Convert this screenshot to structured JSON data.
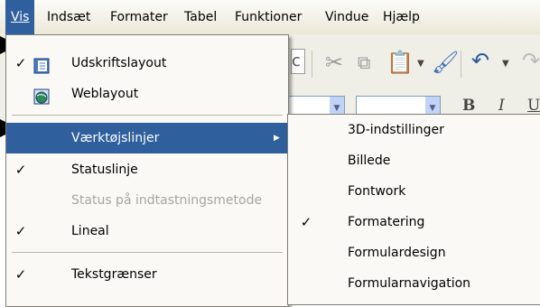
{
  "menubar": {
    "items": [
      {
        "label": "Vis",
        "active": true
      },
      {
        "label": "Indsæt"
      },
      {
        "label": "Formater"
      },
      {
        "label": "Tabel"
      },
      {
        "label": "Funktioner"
      },
      {
        "label": "Vindue"
      },
      {
        "label": "Hjælp"
      }
    ]
  },
  "view_menu": {
    "items": [
      {
        "label": "Udskriftslayout",
        "checked": true,
        "icon": "print-layout-icon"
      },
      {
        "label": "Weblayout",
        "checked": false,
        "icon": "web-layout-icon"
      },
      {
        "label": "Værktøjslinjer",
        "submenu": true,
        "highlighted": true
      },
      {
        "label": "Statuslinje",
        "checked": true
      },
      {
        "label": "Status på indtastningsmetode",
        "disabled": true
      },
      {
        "label": "Lineal",
        "checked": true
      },
      {
        "label": "Tekstgrænser",
        "checked": true
      }
    ]
  },
  "toolbars_submenu": {
    "items": [
      {
        "label": "3D-indstillinger"
      },
      {
        "label": "Billede"
      },
      {
        "label": "Fontwork"
      },
      {
        "label": "Formatering",
        "checked": true
      },
      {
        "label": "Formulardesign"
      },
      {
        "label": "Formularnavigation"
      }
    ]
  },
  "glyphs": {
    "check": "✓",
    "submenu_arrow": "▶"
  },
  "colors": {
    "highlight": "#2f5f9d",
    "menu_bg": "#faf9f6",
    "disabled_text": "#a7a69f"
  }
}
